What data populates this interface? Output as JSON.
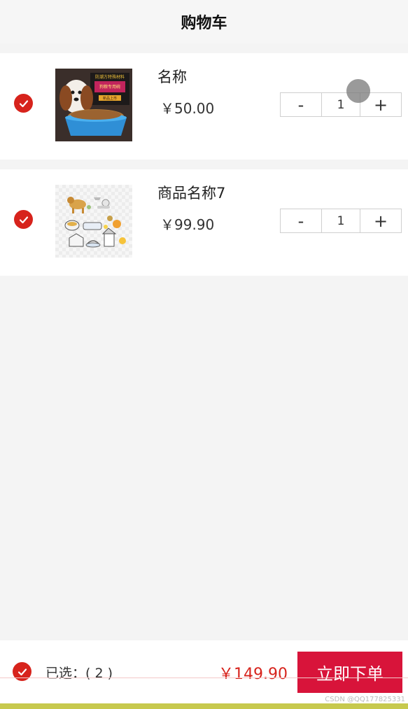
{
  "header": {
    "title": "购物车"
  },
  "items": [
    {
      "name": "名称",
      "price": "￥50.00",
      "quantity": "1",
      "minus": "-",
      "plus": "+",
      "checked": true
    },
    {
      "name": "商品名称7",
      "price": "￥99.90",
      "quantity": "1",
      "minus": "-",
      "plus": "+",
      "checked": true
    }
  ],
  "thumbnail_1": {
    "banner_line_1": "防潮方特殊材料",
    "banner_line_2": "狗粮专用碗",
    "banner_line_3": "新品上市"
  },
  "footer": {
    "selected_label": "已选：( 2 )",
    "total": "￥149.90",
    "order_button": "立即下单",
    "all_checked": true
  },
  "watermark": "CSDN @QQ177825331",
  "colors": {
    "accent": "#d7231c",
    "order_button": "#d8143a",
    "page_bg": "#f4f4f4"
  }
}
